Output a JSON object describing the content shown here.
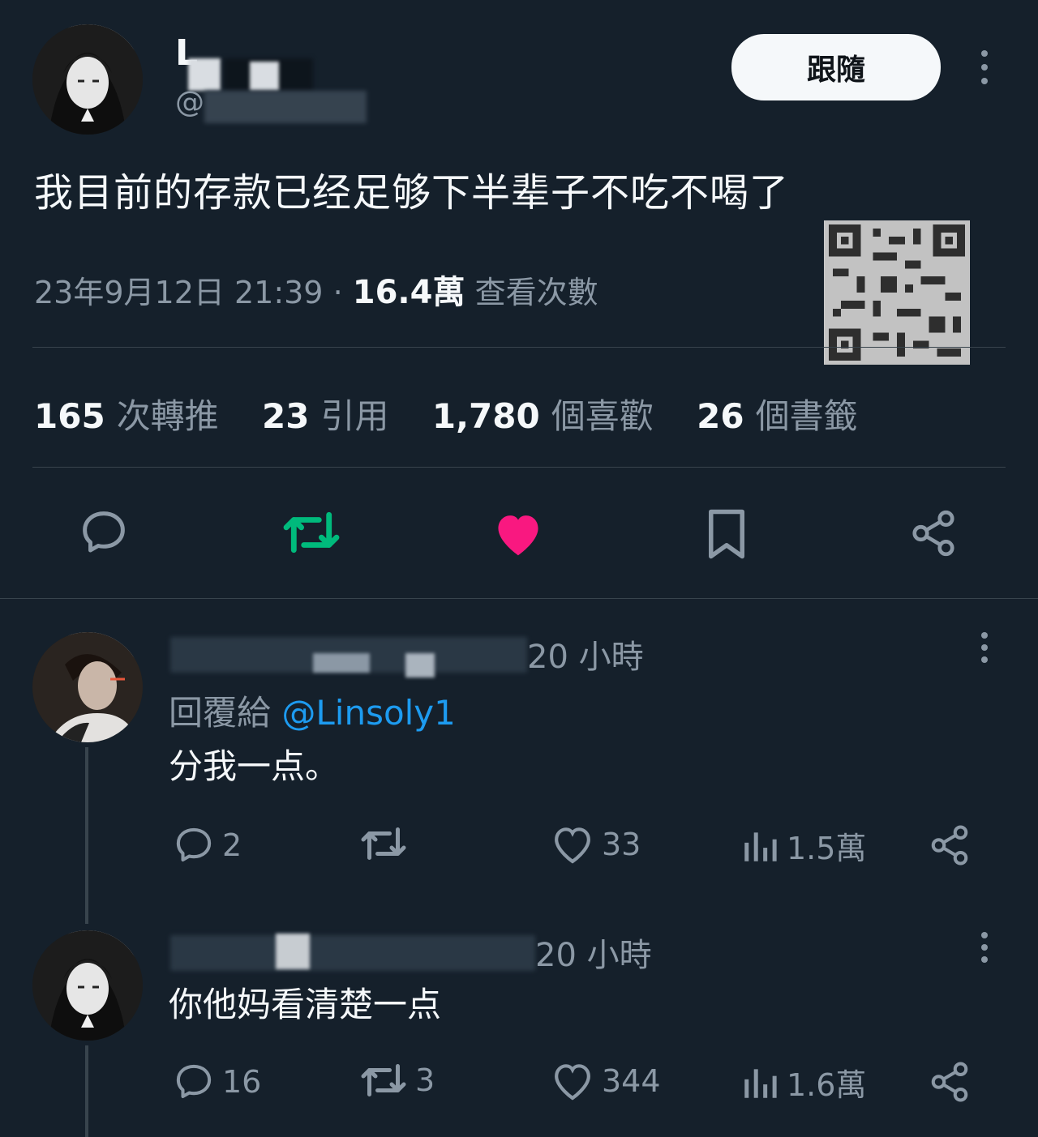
{
  "header": {
    "display_name": "L",
    "handle": "@",
    "follow_label": "跟隨"
  },
  "tweet": {
    "text": "我目前的存款已经足够下半辈子不吃不喝了",
    "timestamp": "23年9月12日 21:39",
    "separator": "·",
    "views_count": "16.4萬",
    "views_label": "查看次數"
  },
  "stats": [
    {
      "count": "165",
      "label": "次轉推"
    },
    {
      "count": "23",
      "label": "引用"
    },
    {
      "count": "1,780",
      "label": "個喜歡"
    },
    {
      "count": "26",
      "label": "個書籤"
    }
  ],
  "replies": [
    {
      "time": "20 小時",
      "reply_to_prefix": "回覆給",
      "reply_to_handle": "@Linsoly1",
      "text": "分我一点。",
      "replies": "2",
      "retweets": "",
      "likes": "33",
      "views": "1.5萬"
    },
    {
      "time": "20 小時",
      "text": "你他妈看清楚一点",
      "replies": "16",
      "retweets": "3",
      "likes": "344",
      "views": "1.6萬"
    }
  ],
  "colors": {
    "background": "#15202b",
    "retweet_active": "#00ba7c",
    "like_active": "#f91880",
    "link": "#1d9bf0"
  },
  "icons": [
    "reply-icon",
    "retweet-icon",
    "like-icon",
    "bookmark-icon",
    "share-icon",
    "views-icon",
    "more-icon"
  ]
}
